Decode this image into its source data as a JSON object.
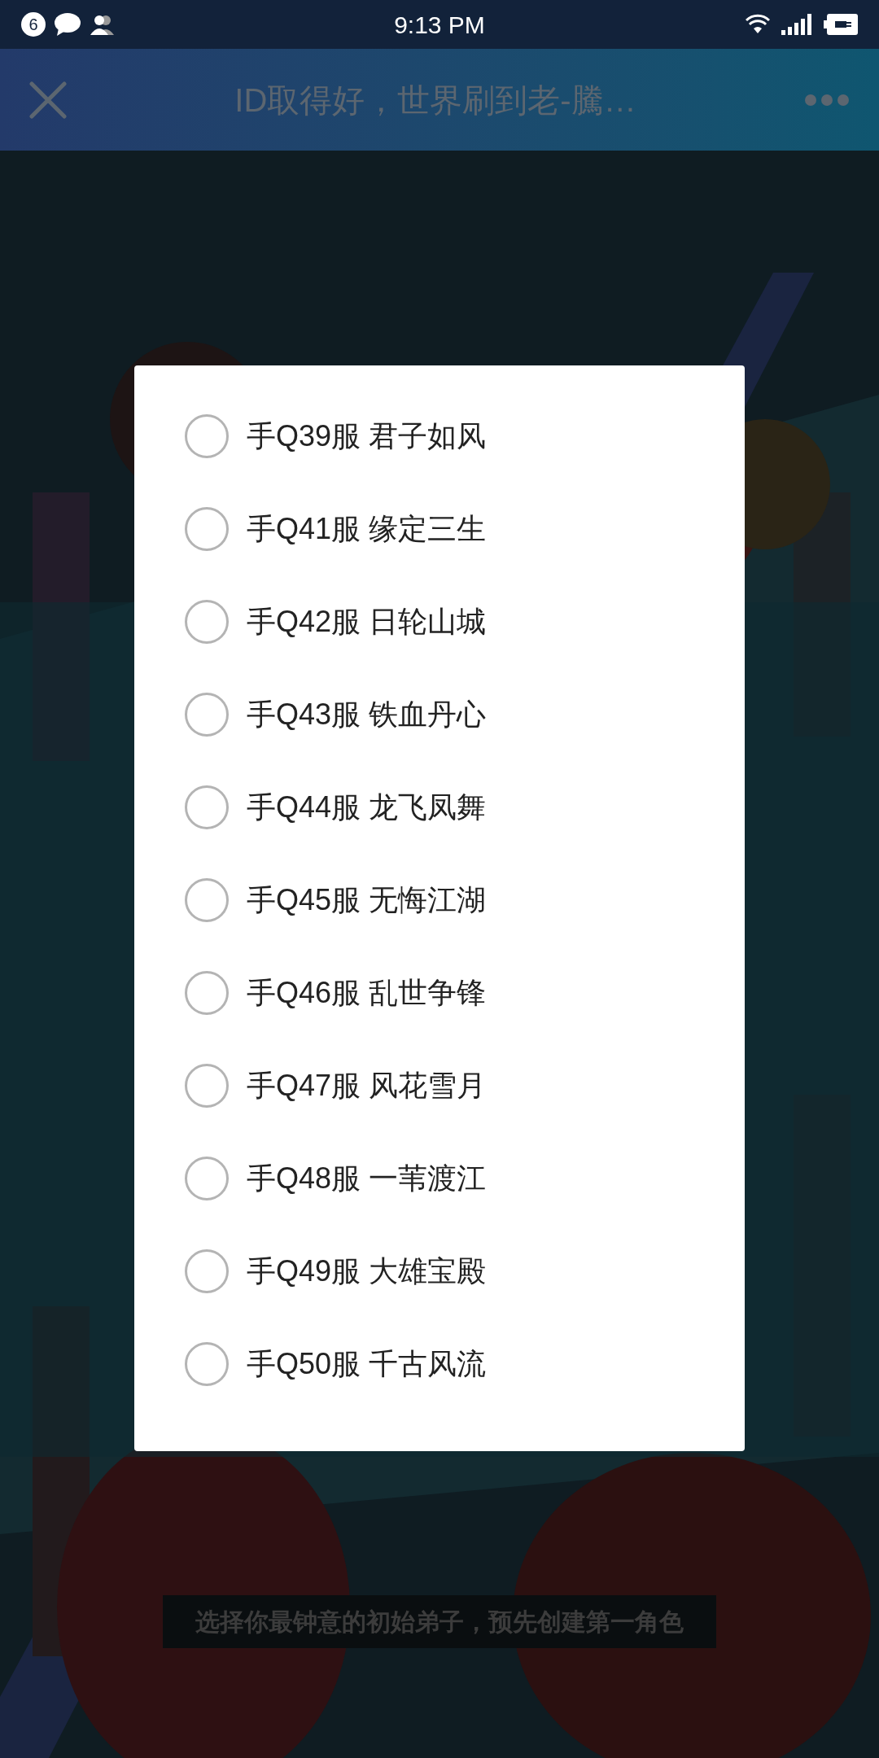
{
  "status_bar": {
    "notification_count": "6",
    "time": "9:13 PM"
  },
  "title_bar": {
    "title": "ID取得好，世界刷到老-騰…"
  },
  "caption": "选择你最钟意的初始弟子，预先创建第一角色",
  "dialog": {
    "options": [
      {
        "label": "手Q39服 君子如风",
        "selected": false
      },
      {
        "label": "手Q41服 缘定三生",
        "selected": false
      },
      {
        "label": "手Q42服 日轮山城",
        "selected": false
      },
      {
        "label": "手Q43服 铁血丹心",
        "selected": false
      },
      {
        "label": "手Q44服 龙飞凤舞",
        "selected": false
      },
      {
        "label": "手Q45服 无悔江湖",
        "selected": false
      },
      {
        "label": "手Q46服 乱世争锋",
        "selected": false
      },
      {
        "label": "手Q47服 风花雪月",
        "selected": false
      },
      {
        "label": "手Q48服 一苇渡江",
        "selected": false
      },
      {
        "label": "手Q49服 大雄宝殿",
        "selected": false
      },
      {
        "label": "手Q50服 千古风流",
        "selected": false
      }
    ]
  }
}
